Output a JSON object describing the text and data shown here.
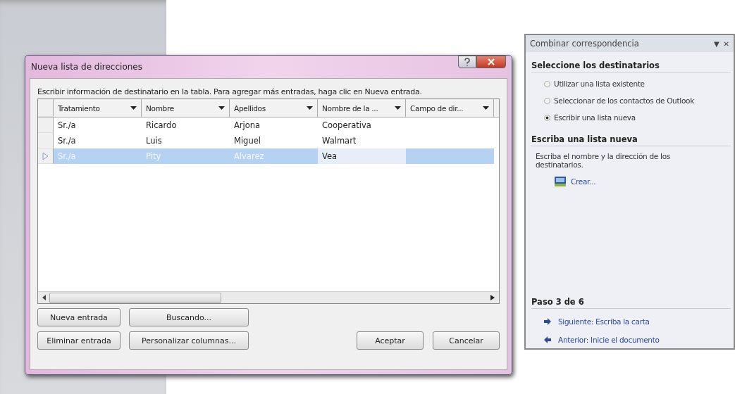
{
  "dialog": {
    "title": "Nueva lista de direcciones",
    "instruction": "Escribir información de destinatario en la tabla. Para agregar más entradas, haga clic en Nueva entrada.",
    "table": {
      "columns": [
        "Tratamiento",
        "Nombre",
        "Apellidos",
        "Nombre de la ...",
        "Campo de dir..."
      ],
      "rows": [
        {
          "cells": [
            "Sr./a",
            "Ricardo",
            "Arjona",
            "Cooperativa"
          ],
          "selected": false
        },
        {
          "cells": [
            "Sr./a",
            "Luis",
            "Miguel",
            "Walmart"
          ],
          "selected": false
        },
        {
          "cells": [
            "Sr./a",
            "Pity",
            "Alvarez",
            "Vea"
          ],
          "selected": true
        }
      ]
    },
    "buttons_left": [
      [
        "Nueva entrada",
        "Buscando..."
      ],
      [
        "Eliminar entrada",
        "Personalizar columnas..."
      ]
    ],
    "buttons_right": [
      "Aceptar",
      "Cancelar"
    ]
  },
  "task_pane": {
    "title": "Combinar correspondencia",
    "close": "✕",
    "menu": "▼",
    "section_1": "Seleccione los destinatarios",
    "options": [
      {
        "label": "Utilizar una lista existente",
        "selected": false
      },
      {
        "label": "Seleccionar de los contactos de Outlook",
        "selected": false
      },
      {
        "label": "Escribir una lista nueva",
        "selected": true
      }
    ],
    "section_2": "Escriba una lista nueva",
    "description": "Escriba el nombre y la dirección de los destinatarios.",
    "create_link": "Crear...",
    "step": "Paso 3 de 6",
    "nav_links": [
      {
        "kind": "next",
        "label": "Siguiente: Escriba la carta"
      },
      {
        "kind": "previous",
        "label": "Anterior: Inicie el documento"
      }
    ]
  }
}
